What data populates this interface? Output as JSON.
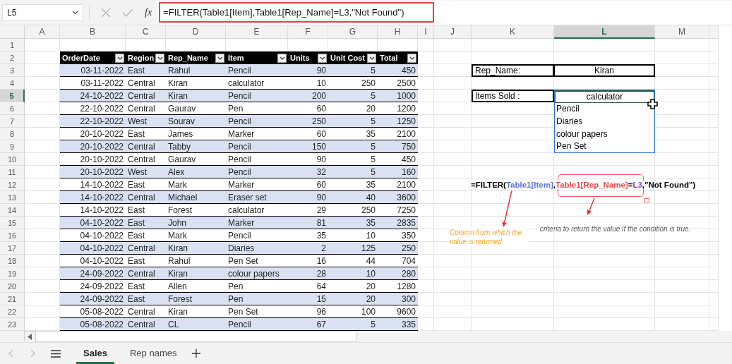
{
  "formula_bar": {
    "name_box": "L5",
    "function_label": "fx",
    "formula": "=FILTER(Table1[Item],Table1[Rep_Name]=L3,\"Not Found\")"
  },
  "columns": [
    {
      "label": "A",
      "selected": false
    },
    {
      "label": "B",
      "selected": false
    },
    {
      "label": "C",
      "selected": false
    },
    {
      "label": "D",
      "selected": false
    },
    {
      "label": "E",
      "selected": false
    },
    {
      "label": "F",
      "selected": false
    },
    {
      "label": "G",
      "selected": false
    },
    {
      "label": "H",
      "selected": false
    },
    {
      "label": "I",
      "selected": false
    },
    {
      "label": "J",
      "selected": false
    },
    {
      "label": "K",
      "selected": false
    },
    {
      "label": "L",
      "selected": true
    },
    {
      "label": "M",
      "selected": false
    }
  ],
  "rows": [
    {
      "label": "1",
      "selected": false
    },
    {
      "label": "2",
      "selected": false
    },
    {
      "label": "3",
      "selected": false
    },
    {
      "label": "4",
      "selected": false
    },
    {
      "label": "5",
      "selected": true
    },
    {
      "label": "6",
      "selected": false
    },
    {
      "label": "7",
      "selected": false
    },
    {
      "label": "8",
      "selected": false
    },
    {
      "label": "9",
      "selected": false
    },
    {
      "label": "10",
      "selected": false
    },
    {
      "label": "11",
      "selected": false
    },
    {
      "label": "12",
      "selected": false
    },
    {
      "label": "13",
      "selected": false
    },
    {
      "label": "14",
      "selected": false
    },
    {
      "label": "15",
      "selected": false
    },
    {
      "label": "16",
      "selected": false
    },
    {
      "label": "17",
      "selected": false
    },
    {
      "label": "18",
      "selected": false
    },
    {
      "label": "19",
      "selected": false
    },
    {
      "label": "20",
      "selected": false
    },
    {
      "label": "21",
      "selected": false
    },
    {
      "label": "22",
      "selected": false
    },
    {
      "label": "23",
      "selected": false
    }
  ],
  "table": {
    "columns": [
      "OrderDate",
      "Region",
      "Rep_Name",
      "Item",
      "Units",
      "Unit Cost",
      "Total"
    ],
    "rows": [
      [
        "03-11-2022",
        "East",
        "Rahul",
        "Pencil",
        "90",
        "5",
        "450"
      ],
      [
        "03-11-2022",
        "Central",
        "Kiran",
        "calculator",
        "10",
        "250",
        "2500"
      ],
      [
        "24-10-2022",
        "Central",
        "Kiran",
        "Pencil",
        "200",
        "5",
        "1000"
      ],
      [
        "22-10-2022",
        "Central",
        "Gaurav",
        "Pen",
        "60",
        "20",
        "1200"
      ],
      [
        "22-10-2022",
        "West",
        "Sourav",
        "Pencil",
        "250",
        "5",
        "1250"
      ],
      [
        "20-10-2022",
        "East",
        "James",
        "Marker",
        "60",
        "35",
        "2100"
      ],
      [
        "20-10-2022",
        "Central",
        "Tabby",
        "Pencil",
        "150",
        "5",
        "750"
      ],
      [
        "20-10-2022",
        "Central",
        "Gaurav",
        "Pencil",
        "90",
        "5",
        "450"
      ],
      [
        "20-10-2022",
        "West",
        "Alex",
        "Pencil",
        "32",
        "5",
        "160"
      ],
      [
        "14-10-2022",
        "East",
        "Mark",
        "Marker",
        "60",
        "35",
        "2100"
      ],
      [
        "14-10-2022",
        "Central",
        "Michael",
        "Eraser set",
        "90",
        "40",
        "3600"
      ],
      [
        "14-10-2022",
        "East",
        "Forest",
        "calculator",
        "29",
        "250",
        "7250"
      ],
      [
        "04-10-2022",
        "East",
        "John",
        "Marker",
        "81",
        "35",
        "2835"
      ],
      [
        "04-10-2022",
        "East",
        "Mark",
        "Pencil",
        "35",
        "10",
        "350"
      ],
      [
        "04-10-2022",
        "Central",
        "Kiran",
        "Diaries",
        "2",
        "125",
        "250"
      ],
      [
        "04-10-2022",
        "East",
        "Rahul",
        "Pen Set",
        "16",
        "44",
        "704"
      ],
      [
        "24-09-2022",
        "Central",
        "Kiran",
        "colour papers",
        "28",
        "10",
        "280"
      ],
      [
        "24-09-2022",
        "East",
        "Allen",
        "Pen",
        "64",
        "20",
        "1280"
      ],
      [
        "24-09-2022",
        "East",
        "Forest",
        "Pen",
        "15",
        "20",
        "300"
      ],
      [
        "05-08-2022",
        "Central",
        "Kiran",
        "Pen Set",
        "96",
        "100",
        "9600"
      ],
      [
        "05-08-2022",
        "Central",
        "CL",
        "Pencil",
        "67",
        "5",
        "335"
      ]
    ]
  },
  "lookup": {
    "rep_label": "Rep_Name:",
    "rep_value": "Kiran",
    "items_label": "Items Sold :",
    "items": [
      "calculator",
      "Pencil",
      "Diaries",
      "colour papers",
      "Pen Set"
    ]
  },
  "annotation": {
    "formula": [
      {
        "text": "=FILTER("
      },
      {
        "text": "Table1[Item]",
        "color": "#5a72dc"
      },
      {
        "text": ","
      },
      {
        "text": "Table1[Rep_Name]",
        "color": "#e04a4e"
      },
      {
        "text": "="
      },
      {
        "text": "L3",
        "color": "#8a44c0"
      },
      {
        "text": ",\"Not Found\")"
      }
    ],
    "notes": [
      {
        "kind": "column",
        "text": "Column from which the value is returned"
      },
      {
        "kind": "criteria",
        "text": "criteria to return the value if the condition is true."
      }
    ]
  },
  "sheet_tabs": [
    {
      "label": "Sales",
      "selected": true
    },
    {
      "label": "Rep names",
      "selected": false
    }
  ]
}
